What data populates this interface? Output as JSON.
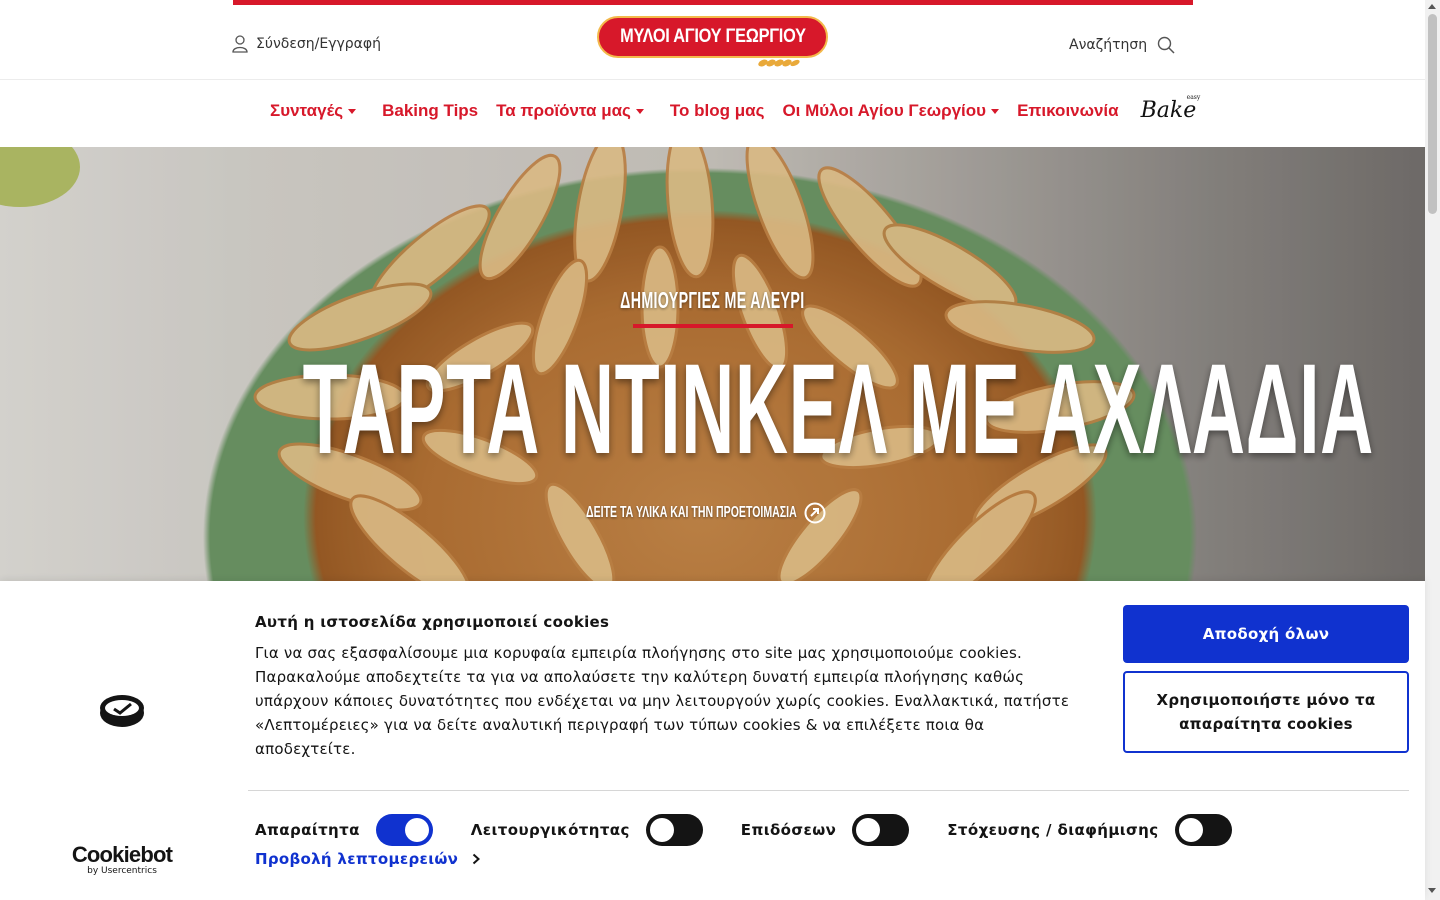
{
  "header": {
    "login_label": "Σύνδεση/Εγγραφή",
    "logo_text": "ΜΥΛΟΙ ΑΓΙΟΥ ΓΕΩΡΓΙΟΥ",
    "search_label": "Αναζήτηση"
  },
  "nav": {
    "items": [
      {
        "label": "Συνταγές",
        "dropdown": true
      },
      {
        "label": "Baking Tips",
        "dropdown": false
      },
      {
        "label": "Τα προϊόντα μας",
        "dropdown": true
      },
      {
        "label": "Το blog μας",
        "dropdown": false
      },
      {
        "label": "Οι Μύλοι Αγίου Γεωργίου",
        "dropdown": true
      },
      {
        "label": "Επικοινωνία",
        "dropdown": false
      }
    ],
    "bake_logo": "Bake",
    "bake_sup": "easy"
  },
  "hero": {
    "kicker": "ΔΗΜΙΟΥΡΓΙΕΣ ΜΕ ΑΛΕΥΡΙ",
    "title": "ΤΑΡΤΑ ΝΤΙΝΚΕΛ ΜΕ ΑΧΛΑΔΙΑ",
    "cta": "ΔΕΙΤΕ ΤΑ ΥΛΙΚΑ ΚΑΙ ΤΗΝ ΠΡΟΕΤΟΙΜΑΣΙΑ"
  },
  "cookie": {
    "title": "Αυτή η ιστοσελίδα χρησιμοποιεί cookies",
    "body": "Για να σας εξασφαλίσουμε μια κορυφαία εμπειρία πλοήγησης στο site μας χρησιμοποιούμε cookies. Παρακαλούμε αποδεχτείτε τα για να απολαύσετε την καλύτερη δυνατή εμπειρία πλοήγησης καθώς υπάρχουν κάποιες δυνατότητες που ενδέχεται να μην λειτουργούν χωρίς cookies. Εναλλακτικά, πατήστε «Λεπτομέρειες» για να δείτε αναλυτική περιγραφή των τύπων cookies & να επιλέξετε ποια θα αποδεχτείτε.",
    "accept_all": "Αποδοχή όλων",
    "necessary_only": "Χρησιμοποιήστε μόνο τα απαραίτητα cookies",
    "toggles": [
      {
        "label": "Απαραίτητα",
        "on": true
      },
      {
        "label": "Λειτουργικότητας",
        "on": false
      },
      {
        "label": "Επιδόσεων",
        "on": false
      },
      {
        "label": "Στόχευσης / διαφήμισης",
        "on": false
      }
    ],
    "details_link": "Προβολή λεπτομερειών",
    "brand_name": "Cookiebot",
    "brand_by": "by Usercentrics"
  },
  "colors": {
    "brand_red": "#d7182a",
    "cookie_blue": "#1032cf"
  }
}
